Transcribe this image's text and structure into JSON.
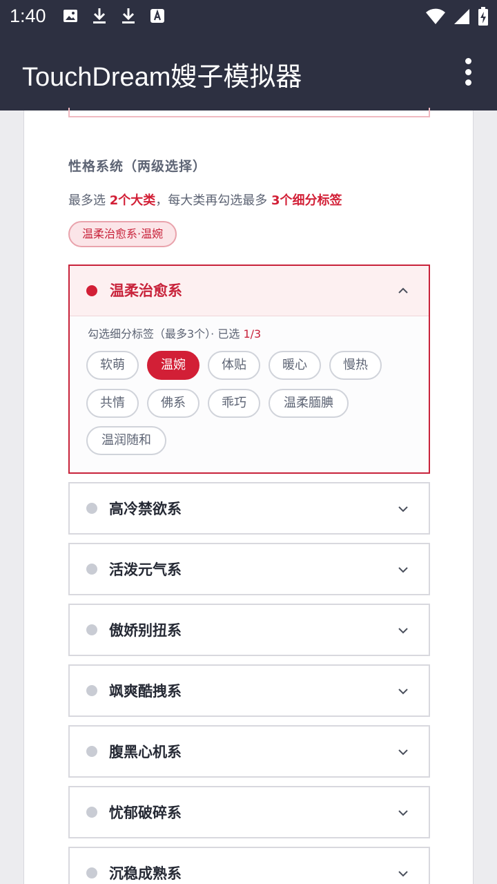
{
  "status_bar": {
    "time": "1:40",
    "icons": [
      "image-icon",
      "download-icon",
      "download-icon",
      "font-icon",
      "wifi-icon",
      "signal-icon",
      "battery-charging-icon"
    ]
  },
  "app_bar": {
    "title": "TouchDream嫂子模拟器",
    "menu_icon": "more-vert-icon"
  },
  "personality": {
    "section_title": "性格系统（两级选择）",
    "hint_prefix": "最多选 ",
    "hint_major": "2个大类",
    "hint_middle": "，每大类再勾选最多 ",
    "hint_minor": "3个细分标签",
    "selected_chip": "温柔治愈系·温婉",
    "open_group": {
      "name": "温柔治愈系",
      "sub_label": "勾选细分标签（最多3个）· 已选 ",
      "sub_count": "1/3",
      "tags": [
        {
          "label": "软萌",
          "selected": false
        },
        {
          "label": "温婉",
          "selected": true
        },
        {
          "label": "体贴",
          "selected": false
        },
        {
          "label": "暖心",
          "selected": false
        },
        {
          "label": "慢热",
          "selected": false
        },
        {
          "label": "共情",
          "selected": false
        },
        {
          "label": "佛系",
          "selected": false
        },
        {
          "label": "乖巧",
          "selected": false
        },
        {
          "label": "温柔腼腆",
          "selected": false
        },
        {
          "label": "温润随和",
          "selected": false
        }
      ]
    },
    "groups": [
      {
        "name": "高冷禁欲系"
      },
      {
        "name": "活泼元气系"
      },
      {
        "name": "傲娇别扭系"
      },
      {
        "name": "飒爽酷拽系"
      },
      {
        "name": "腹黑心机系"
      },
      {
        "name": "忧郁破碎系"
      },
      {
        "name": "沉稳成熟系"
      }
    ]
  },
  "colors": {
    "bar": "#2d3041",
    "accent": "#d21f36",
    "muted_dot": "#c9ccd4"
  }
}
